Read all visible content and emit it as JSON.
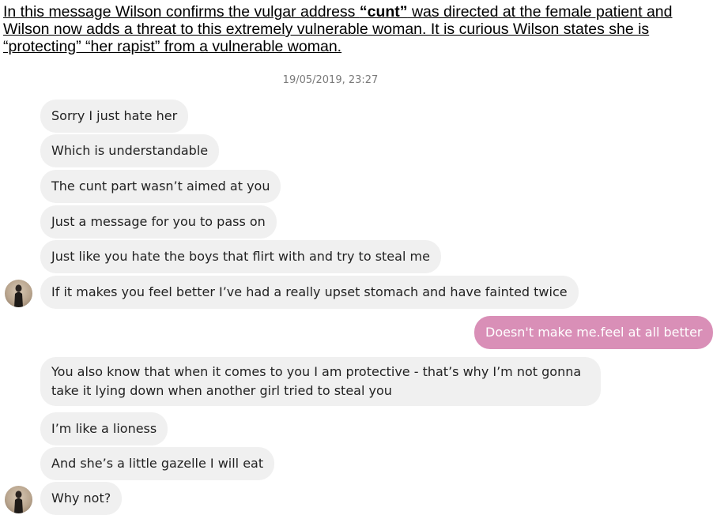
{
  "caption": {
    "part1": "In this message Wilson confirms the vulgar address ",
    "bold": "“cunt”",
    "part2": " was directed at the female patient and Wilson now adds a threat to this extremely vulnerable woman. It is curious Wilson states she is “protecting” “her rapist” from a vulnerable woman."
  },
  "conversation": {
    "timestamp": "19/05/2019, 23:27",
    "messages": [
      {
        "text": "Sorry I just hate her",
        "from": "received"
      },
      {
        "text": "Which is understandable",
        "from": "received"
      },
      {
        "text": "The cunt part wasn’t aimed at you",
        "from": "received"
      },
      {
        "text": "Just a message for you to pass on",
        "from": "received"
      },
      {
        "text": "Just like you hate the boys that flirt with and try to steal me",
        "from": "received"
      },
      {
        "text": "If it makes you feel better I’ve had a really upset stomach and have fainted twice",
        "from": "received"
      },
      {
        "text": "Doesn't make me.feel at all better",
        "from": "sent"
      },
      {
        "text": "You also know that when it comes to you I am protective - that’s why I’m not gonna take it lying down when another girl tried to steal you",
        "from": "received"
      },
      {
        "text": "I’m like a lioness",
        "from": "received"
      },
      {
        "text": "And she’s a little gazelle I will eat",
        "from": "received"
      },
      {
        "text": "Why not?",
        "from": "received"
      }
    ]
  },
  "colors": {
    "received_bubble": "#f0f0f0",
    "sent_bubble": "#d98fb7",
    "timestamp_text": "#7a7a7a"
  },
  "icons": [
    "contact-avatar-icon"
  ]
}
